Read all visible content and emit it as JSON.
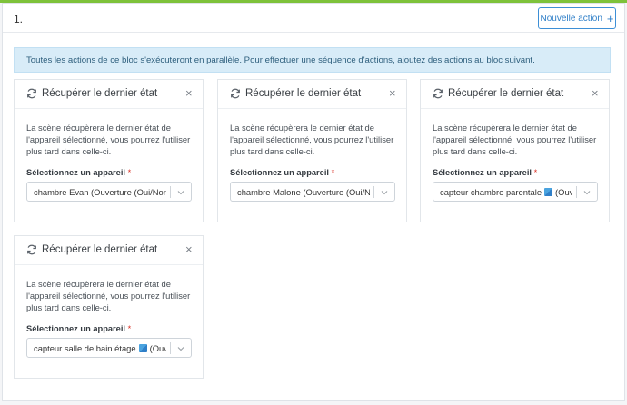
{
  "block": {
    "index": "1.",
    "new_action_label": "Nouvelle action",
    "info": "Toutes les actions de ce bloc s'exécuteront en parallèle. Pour effectuer une séquence d'actions, ajoutez des actions au bloc suivant."
  },
  "cards": [
    {
      "title": "Récupérer le dernier état",
      "description": "La scène récupèrera le dernier état de l'appareil sélectionné, vous pourrez l'utiliser plus tard dans celle-ci.",
      "field_label": "Sélectionnez un appareil",
      "required_mark": "*",
      "selected": "chambre Evan (Ouverture (Oui/Non))"
    },
    {
      "title": "Récupérer le dernier état",
      "description": "La scène récupèrera le dernier état de l'appareil sélectionné, vous pourrez l'utiliser plus tard dans celle-ci.",
      "field_label": "Sélectionnez un appareil",
      "required_mark": "*",
      "selected": "chambre Malone (Ouverture (Oui/No..."
    },
    {
      "title": "Récupérer le dernier état",
      "description": "La scène récupèrera le dernier état de l'appareil sélectionné, vous pourrez l'utiliser plus tard dans celle-ci.",
      "field_label": "Sélectionnez un appareil",
      "required_mark": "*",
      "selected_prefix": "capteur chambre parentale",
      "selected_suffix": "(Ouve...",
      "icon": "sensor-icon"
    },
    {
      "title": "Récupérer le dernier état",
      "description": "La scène récupèrera le dernier état de l'appareil sélectionné, vous pourrez l'utiliser plus tard dans celle-ci.",
      "field_label": "Sélectionnez un appareil",
      "required_mark": "*",
      "selected_prefix": "capteur salle de bain étage",
      "selected_suffix": "(Ouve...",
      "icon": "sensor-icon"
    }
  ],
  "colors": {
    "accent": "#7ec23a",
    "primary": "#2f7fc8",
    "info_bg": "#d8ecf8",
    "required": "#d93025"
  }
}
